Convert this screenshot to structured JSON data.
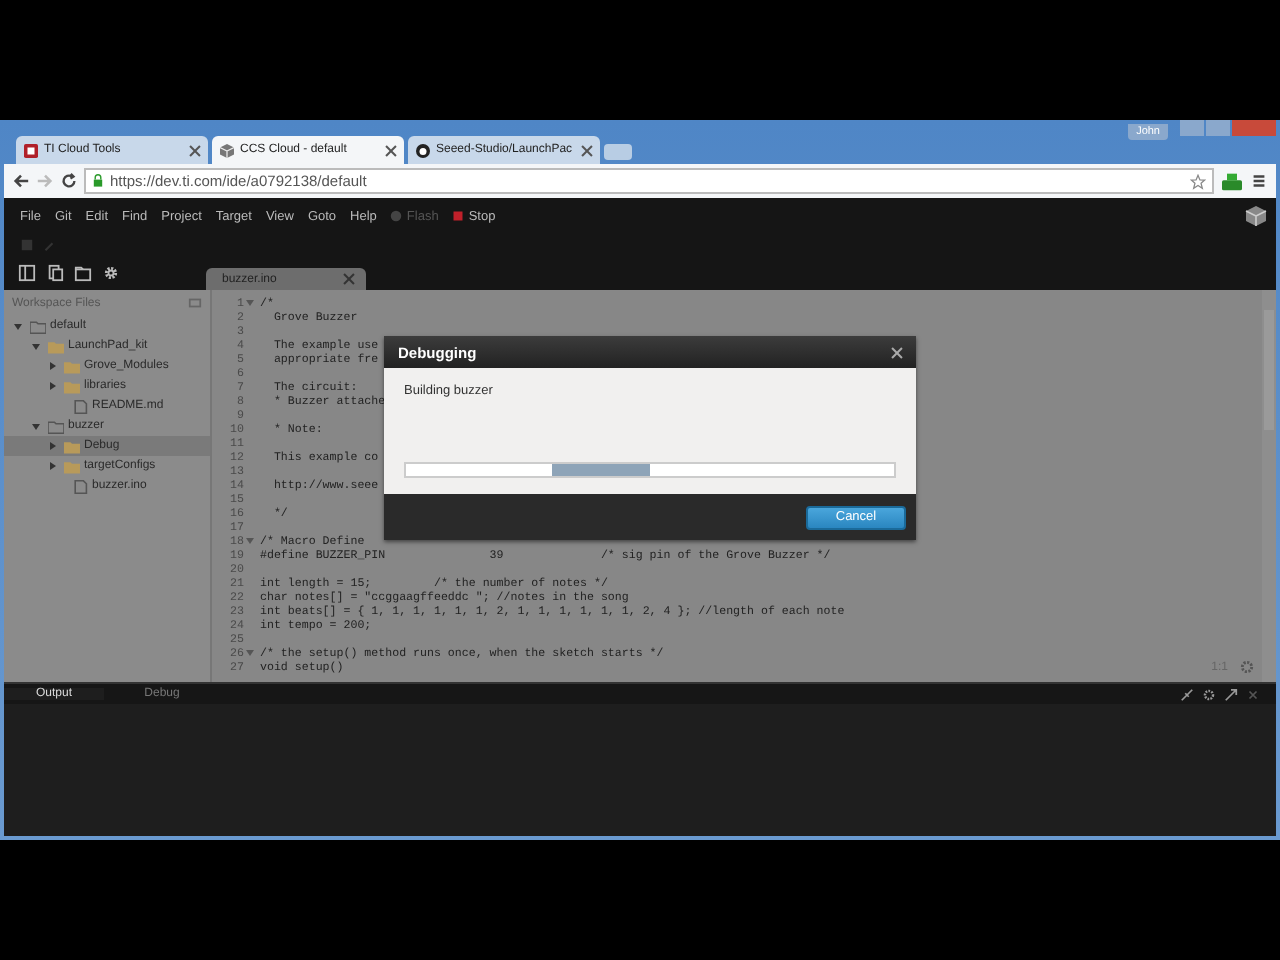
{
  "browser": {
    "tabs": [
      {
        "label": "TI Cloud Tools",
        "selected": false,
        "kind": "ti"
      },
      {
        "label": "CCS Cloud - default",
        "selected": true,
        "kind": "cube"
      },
      {
        "label": "Seeed-Studio/LaunchPac",
        "selected": false,
        "kind": "github"
      }
    ],
    "user": "John",
    "url": "https://dev.ti.com/ide/a0792138/default"
  },
  "menu": [
    {
      "label": "File",
      "disabled": false,
      "kind": "text"
    },
    {
      "label": "Git",
      "disabled": false,
      "kind": "text"
    },
    {
      "label": "Edit",
      "disabled": false,
      "kind": "text"
    },
    {
      "label": "Find",
      "disabled": false,
      "kind": "text"
    },
    {
      "label": "Project",
      "disabled": false,
      "kind": "text"
    },
    {
      "label": "Target",
      "disabled": false,
      "kind": "text"
    },
    {
      "label": "View",
      "disabled": false,
      "kind": "text"
    },
    {
      "label": "Goto",
      "disabled": false,
      "kind": "text"
    },
    {
      "label": "Help",
      "disabled": false,
      "kind": "text"
    },
    {
      "label": "Flash",
      "disabled": true,
      "kind": "flash"
    },
    {
      "label": "Stop",
      "disabled": false,
      "kind": "stop"
    }
  ],
  "editor_tab": {
    "label": "buzzer.ino",
    "selected": true
  },
  "sidebar": {
    "title": "Workspace Files",
    "tree": [
      {
        "label": "default",
        "kind": "project",
        "expanded": true,
        "selected": false,
        "children": [
          {
            "label": "LaunchPad_kit",
            "kind": "folder",
            "expanded": true,
            "selected": false,
            "children": [
              {
                "label": "Grove_Modules",
                "kind": "folder",
                "expanded": false,
                "selected": false
              },
              {
                "label": "libraries",
                "kind": "folder",
                "expanded": false,
                "selected": false
              },
              {
                "label": "README.md",
                "kind": "file",
                "selected": false
              }
            ]
          },
          {
            "label": "buzzer",
            "kind": "project",
            "expanded": true,
            "selected": false,
            "children": [
              {
                "label": "Debug",
                "kind": "folder",
                "expanded": false,
                "selected": true
              },
              {
                "label": "targetConfigs",
                "kind": "folder",
                "expanded": false,
                "selected": false
              },
              {
                "label": "buzzer.ino",
                "kind": "file",
                "selected": false
              }
            ]
          }
        ]
      }
    ]
  },
  "code": [
    {
      "n": "1",
      "text": "/*",
      "fold": true
    },
    {
      "n": "2",
      "text": "  Grove Buzzer",
      "fold": false
    },
    {
      "n": "3",
      "fold": false
    },
    {
      "n": "4",
      "text": "  The example use",
      "fold": false
    },
    {
      "n": "5",
      "text": "  appropriate fre",
      "fold": false
    },
    {
      "n": "6",
      "fold": false
    },
    {
      "n": "7",
      "text": "  The circuit:",
      "fold": false
    },
    {
      "n": "8",
      "text": "  * Buzzer attache",
      "fold": false
    },
    {
      "n": "9",
      "fold": false
    },
    {
      "n": "10",
      "text": "  * Note:",
      "fold": false
    },
    {
      "n": "11",
      "fold": false
    },
    {
      "n": "12",
      "text": "  This example co",
      "fold": false
    },
    {
      "n": "13",
      "fold": false
    },
    {
      "n": "14",
      "text": "  http://www.seee",
      "fold": false
    },
    {
      "n": "15",
      "fold": false
    },
    {
      "n": "16",
      "text": "  */",
      "fold": false
    },
    {
      "n": "17",
      "fold": false
    },
    {
      "n": "18",
      "text": "/* Macro Define",
      "fold": true
    },
    {
      "n": "19",
      "text": "#define BUZZER_PIN               39              /* sig pin of the Grove Buzzer */",
      "fold": false
    },
    {
      "n": "20",
      "fold": false
    },
    {
      "n": "21",
      "text": "int length = 15;         /* the number of notes */",
      "fold": false
    },
    {
      "n": "22",
      "text": "char notes[] = \"ccggaagffeeddc \"; //notes in the song",
      "fold": false
    },
    {
      "n": "23",
      "text": "int beats[] = { 1, 1, 1, 1, 1, 1, 2, 1, 1, 1, 1, 1, 1, 2, 4 }; //length of each note",
      "fold": false
    },
    {
      "n": "24",
      "text": "int tempo = 200;",
      "fold": false
    },
    {
      "n": "25",
      "fold": false
    },
    {
      "n": "26",
      "text": "/* the setup() method runs once, when the sketch starts */",
      "fold": true
    },
    {
      "n": "27",
      "text": "void setup()",
      "fold": false
    }
  ],
  "cursor": "1:1",
  "dialog": {
    "title": "Debugging",
    "message": "Building buzzer",
    "progress": {
      "kind": "indeterminate"
    },
    "buttons": [
      "Cancel"
    ]
  },
  "panel": {
    "tabs": [
      {
        "label": "Output",
        "selected": true
      },
      {
        "label": "Debug",
        "selected": false
      }
    ]
  }
}
